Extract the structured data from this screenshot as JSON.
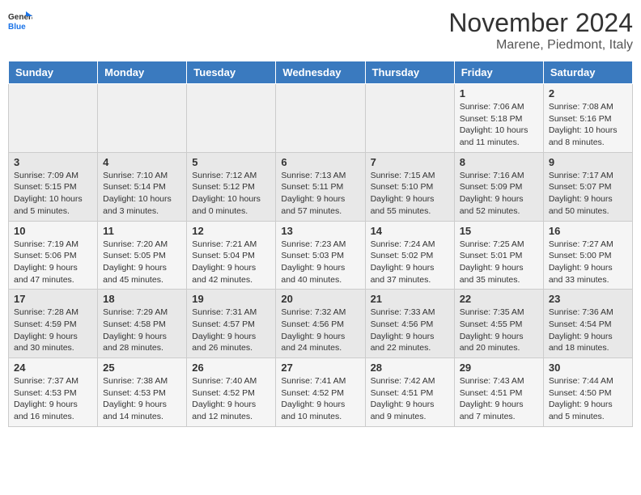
{
  "header": {
    "logo": {
      "general": "General",
      "blue": "Blue"
    },
    "title": "November 2024",
    "location": "Marene, Piedmont, Italy"
  },
  "days_of_week": [
    "Sunday",
    "Monday",
    "Tuesday",
    "Wednesday",
    "Thursday",
    "Friday",
    "Saturday"
  ],
  "weeks": [
    [
      {
        "day": "",
        "info": ""
      },
      {
        "day": "",
        "info": ""
      },
      {
        "day": "",
        "info": ""
      },
      {
        "day": "",
        "info": ""
      },
      {
        "day": "",
        "info": ""
      },
      {
        "day": "1",
        "info": "Sunrise: 7:06 AM\nSunset: 5:18 PM\nDaylight: 10 hours and 11 minutes."
      },
      {
        "day": "2",
        "info": "Sunrise: 7:08 AM\nSunset: 5:16 PM\nDaylight: 10 hours and 8 minutes."
      }
    ],
    [
      {
        "day": "3",
        "info": "Sunrise: 7:09 AM\nSunset: 5:15 PM\nDaylight: 10 hours and 5 minutes."
      },
      {
        "day": "4",
        "info": "Sunrise: 7:10 AM\nSunset: 5:14 PM\nDaylight: 10 hours and 3 minutes."
      },
      {
        "day": "5",
        "info": "Sunrise: 7:12 AM\nSunset: 5:12 PM\nDaylight: 10 hours and 0 minutes."
      },
      {
        "day": "6",
        "info": "Sunrise: 7:13 AM\nSunset: 5:11 PM\nDaylight: 9 hours and 57 minutes."
      },
      {
        "day": "7",
        "info": "Sunrise: 7:15 AM\nSunset: 5:10 PM\nDaylight: 9 hours and 55 minutes."
      },
      {
        "day": "8",
        "info": "Sunrise: 7:16 AM\nSunset: 5:09 PM\nDaylight: 9 hours and 52 minutes."
      },
      {
        "day": "9",
        "info": "Sunrise: 7:17 AM\nSunset: 5:07 PM\nDaylight: 9 hours and 50 minutes."
      }
    ],
    [
      {
        "day": "10",
        "info": "Sunrise: 7:19 AM\nSunset: 5:06 PM\nDaylight: 9 hours and 47 minutes."
      },
      {
        "day": "11",
        "info": "Sunrise: 7:20 AM\nSunset: 5:05 PM\nDaylight: 9 hours and 45 minutes."
      },
      {
        "day": "12",
        "info": "Sunrise: 7:21 AM\nSunset: 5:04 PM\nDaylight: 9 hours and 42 minutes."
      },
      {
        "day": "13",
        "info": "Sunrise: 7:23 AM\nSunset: 5:03 PM\nDaylight: 9 hours and 40 minutes."
      },
      {
        "day": "14",
        "info": "Sunrise: 7:24 AM\nSunset: 5:02 PM\nDaylight: 9 hours and 37 minutes."
      },
      {
        "day": "15",
        "info": "Sunrise: 7:25 AM\nSunset: 5:01 PM\nDaylight: 9 hours and 35 minutes."
      },
      {
        "day": "16",
        "info": "Sunrise: 7:27 AM\nSunset: 5:00 PM\nDaylight: 9 hours and 33 minutes."
      }
    ],
    [
      {
        "day": "17",
        "info": "Sunrise: 7:28 AM\nSunset: 4:59 PM\nDaylight: 9 hours and 30 minutes."
      },
      {
        "day": "18",
        "info": "Sunrise: 7:29 AM\nSunset: 4:58 PM\nDaylight: 9 hours and 28 minutes."
      },
      {
        "day": "19",
        "info": "Sunrise: 7:31 AM\nSunset: 4:57 PM\nDaylight: 9 hours and 26 minutes."
      },
      {
        "day": "20",
        "info": "Sunrise: 7:32 AM\nSunset: 4:56 PM\nDaylight: 9 hours and 24 minutes."
      },
      {
        "day": "21",
        "info": "Sunrise: 7:33 AM\nSunset: 4:56 PM\nDaylight: 9 hours and 22 minutes."
      },
      {
        "day": "22",
        "info": "Sunrise: 7:35 AM\nSunset: 4:55 PM\nDaylight: 9 hours and 20 minutes."
      },
      {
        "day": "23",
        "info": "Sunrise: 7:36 AM\nSunset: 4:54 PM\nDaylight: 9 hours and 18 minutes."
      }
    ],
    [
      {
        "day": "24",
        "info": "Sunrise: 7:37 AM\nSunset: 4:53 PM\nDaylight: 9 hours and 16 minutes."
      },
      {
        "day": "25",
        "info": "Sunrise: 7:38 AM\nSunset: 4:53 PM\nDaylight: 9 hours and 14 minutes."
      },
      {
        "day": "26",
        "info": "Sunrise: 7:40 AM\nSunset: 4:52 PM\nDaylight: 9 hours and 12 minutes."
      },
      {
        "day": "27",
        "info": "Sunrise: 7:41 AM\nSunset: 4:52 PM\nDaylight: 9 hours and 10 minutes."
      },
      {
        "day": "28",
        "info": "Sunrise: 7:42 AM\nSunset: 4:51 PM\nDaylight: 9 hours and 9 minutes."
      },
      {
        "day": "29",
        "info": "Sunrise: 7:43 AM\nSunset: 4:51 PM\nDaylight: 9 hours and 7 minutes."
      },
      {
        "day": "30",
        "info": "Sunrise: 7:44 AM\nSunset: 4:50 PM\nDaylight: 9 hours and 5 minutes."
      }
    ]
  ]
}
